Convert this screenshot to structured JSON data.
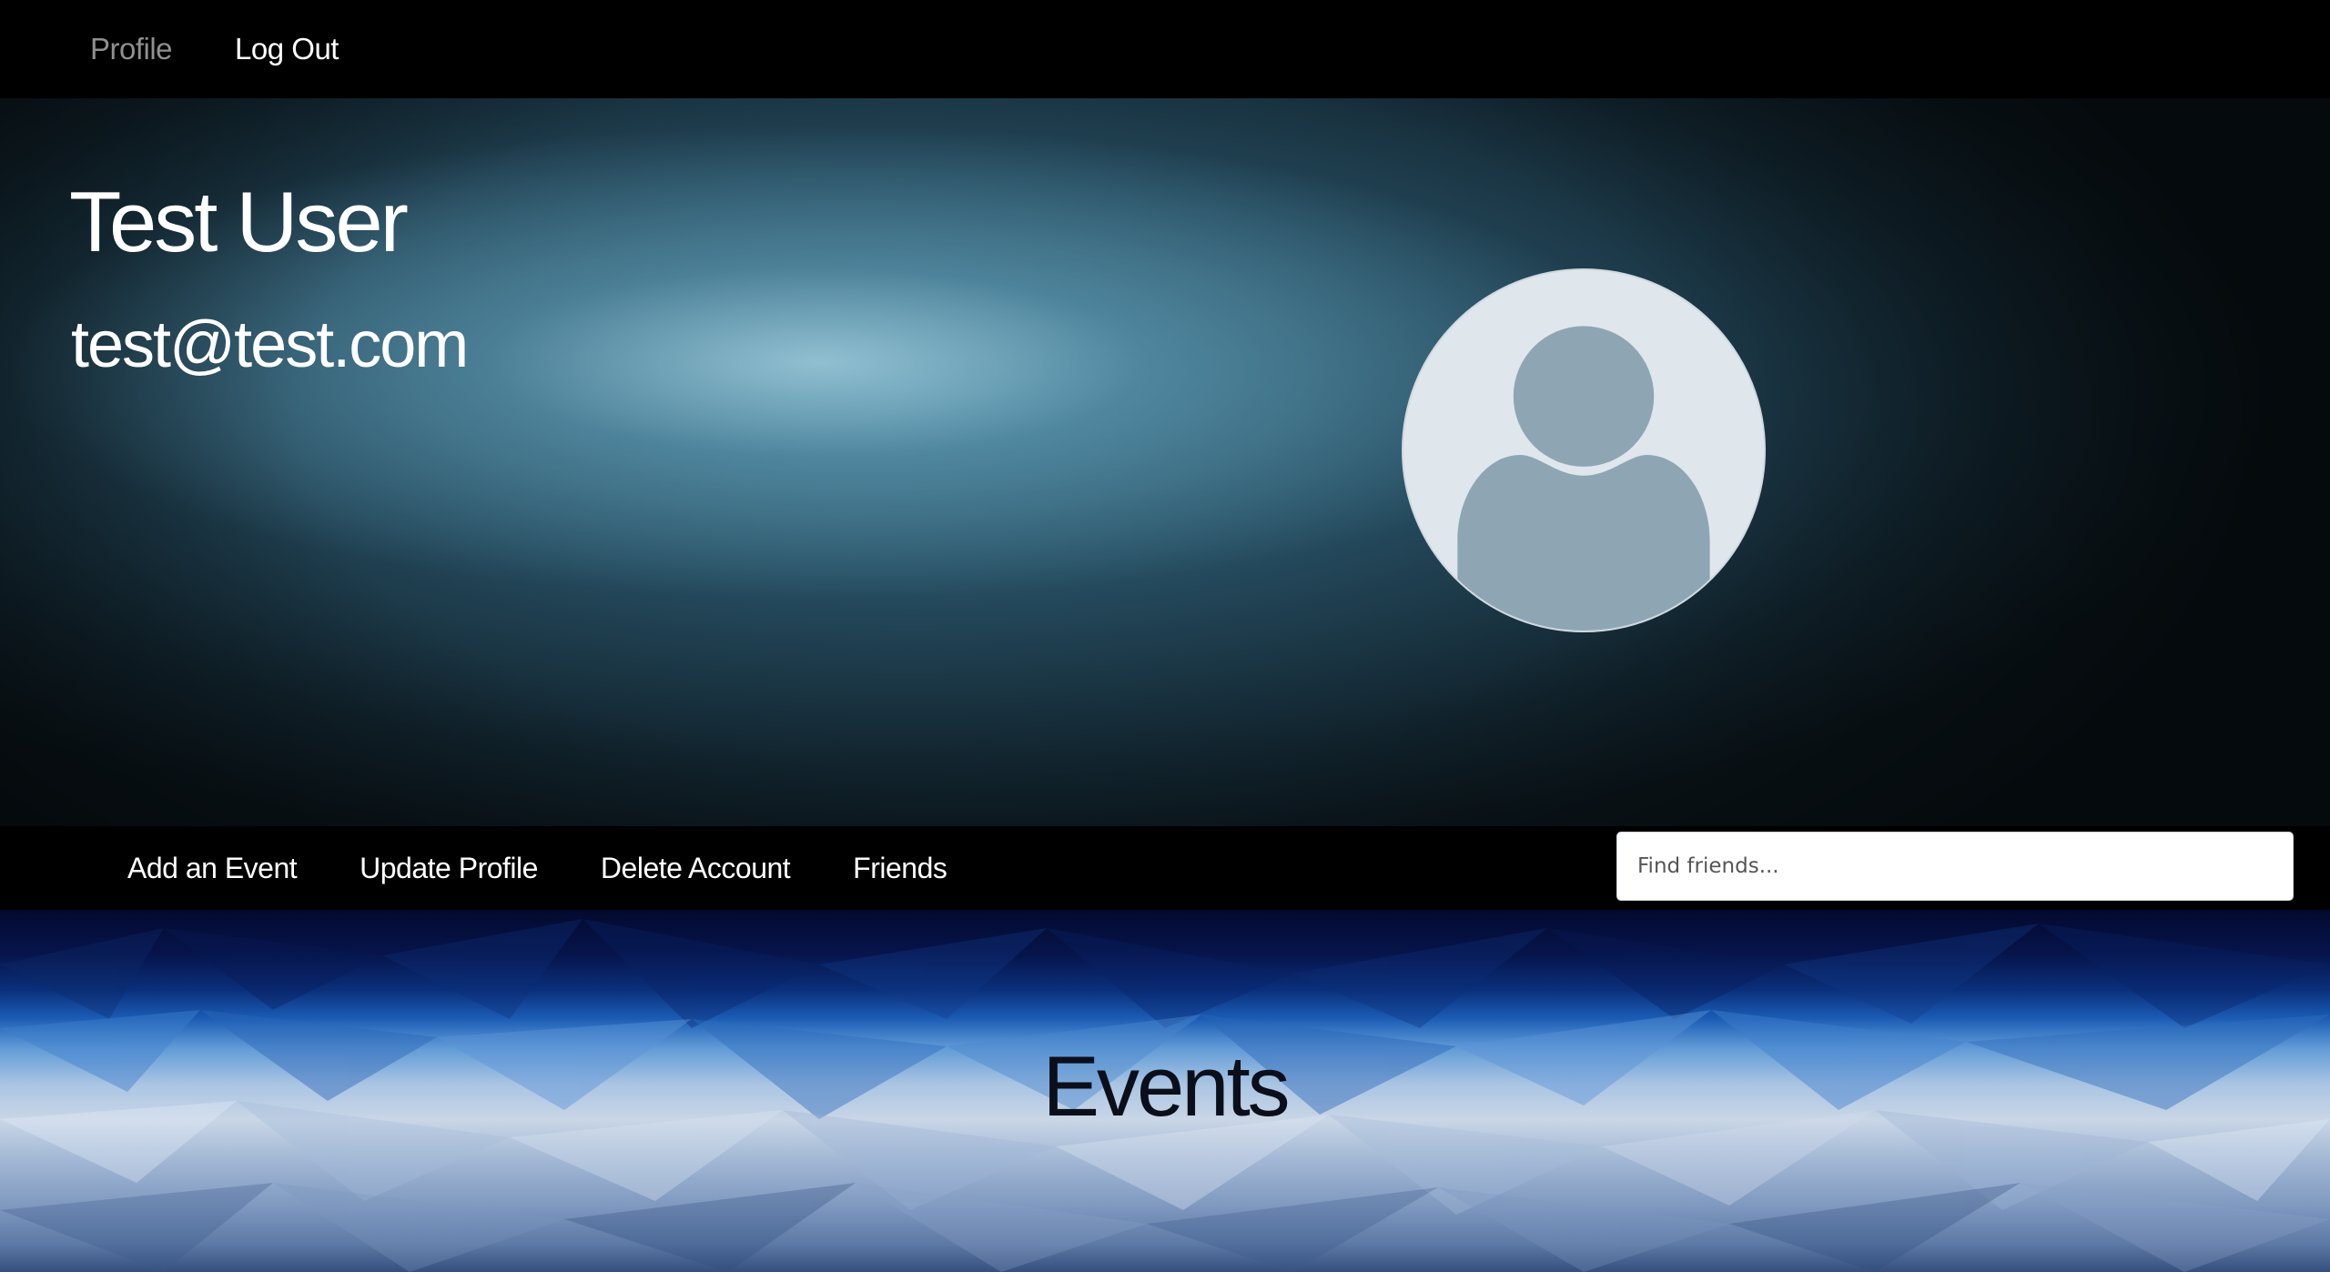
{
  "topnav": {
    "items": [
      {
        "label": "Profile",
        "active": true
      },
      {
        "label": "Log Out",
        "active": false
      }
    ]
  },
  "profile": {
    "name": "Test User",
    "email": "test@test.com",
    "avatar_icon": "user-silhouette-icon"
  },
  "subnav": {
    "items": [
      {
        "label": "Add an Event"
      },
      {
        "label": "Update Profile"
      },
      {
        "label": "Delete Account"
      },
      {
        "label": "Friends"
      }
    ],
    "search": {
      "placeholder": "Find friends...",
      "value": ""
    }
  },
  "events": {
    "title": "Events"
  },
  "colors": {
    "nav_background": "#000000",
    "nav_active_text": "#8f8f8f",
    "nav_text": "#ffffff",
    "avatar_background": "#dfe6ec",
    "avatar_figure": "#8ea6b4"
  }
}
